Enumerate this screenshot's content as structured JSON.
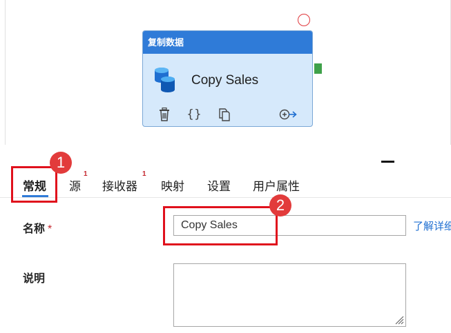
{
  "activity": {
    "type_label": "复制数据",
    "name": "Copy Sales",
    "icons": [
      "database-icon",
      "trash-icon",
      "code-braces-icon",
      "copy-icon",
      "add-output-icon"
    ],
    "braces_glyph": "{}"
  },
  "tabs": [
    {
      "label": "常规",
      "active": true,
      "badge": ""
    },
    {
      "label": "源",
      "active": false,
      "badge": "1"
    },
    {
      "label": "接收器",
      "active": false,
      "badge": "1"
    },
    {
      "label": "映射",
      "active": false,
      "badge": ""
    },
    {
      "label": "设置",
      "active": false,
      "badge": ""
    },
    {
      "label": "用户属性",
      "active": false,
      "badge": ""
    }
  ],
  "form": {
    "name_label": "名称",
    "required_mark": "*",
    "name_value": "Copy Sales",
    "learn_more": "了解详细",
    "description_label": "说明",
    "description_value": ""
  },
  "callouts": [
    "1",
    "2"
  ],
  "colors": {
    "accent": "#2f7bd8",
    "activity_bg": "#d6e9fb",
    "success_port": "#3fa14a",
    "highlight": "#e0101c",
    "callout": "#e23b3b"
  }
}
